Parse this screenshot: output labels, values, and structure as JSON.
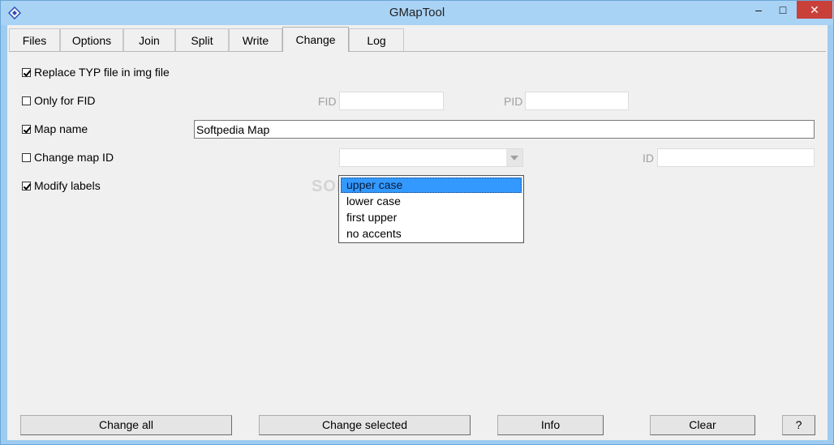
{
  "window": {
    "title": "GMapTool"
  },
  "title_buttons": {
    "minimize": "–",
    "maximize": "□",
    "close": "✕"
  },
  "tabs": [
    {
      "label": "Files"
    },
    {
      "label": "Options"
    },
    {
      "label": "Join"
    },
    {
      "label": "Split"
    },
    {
      "label": "Write"
    },
    {
      "label": "Change",
      "active": true
    },
    {
      "label": "Log"
    }
  ],
  "options": {
    "replace_typ": {
      "label": "Replace TYP file in img file",
      "checked": true
    },
    "only_fid": {
      "label": "Only for FID",
      "checked": false
    },
    "map_name": {
      "label": "Map name",
      "checked": true
    },
    "change_map_id": {
      "label": "Change map ID",
      "checked": false
    },
    "modify_labels": {
      "label": "Modify labels",
      "checked": true
    }
  },
  "fields": {
    "fid_label": "FID",
    "fid_value": "",
    "pid_label": "PID",
    "pid_value": "",
    "map_name_value": "Softpedia Map",
    "map_id_combo_value": "",
    "id_label": "ID",
    "id_value": ""
  },
  "label_case_dropdown": {
    "items": [
      "upper case",
      "lower case",
      "first upper",
      "no accents"
    ],
    "selected": "upper case"
  },
  "watermark": "SOFTPEDIA",
  "buttons": {
    "change_all": "Change all",
    "change_selected": "Change selected",
    "info": "Info",
    "clear": "Clear",
    "help": "?"
  }
}
